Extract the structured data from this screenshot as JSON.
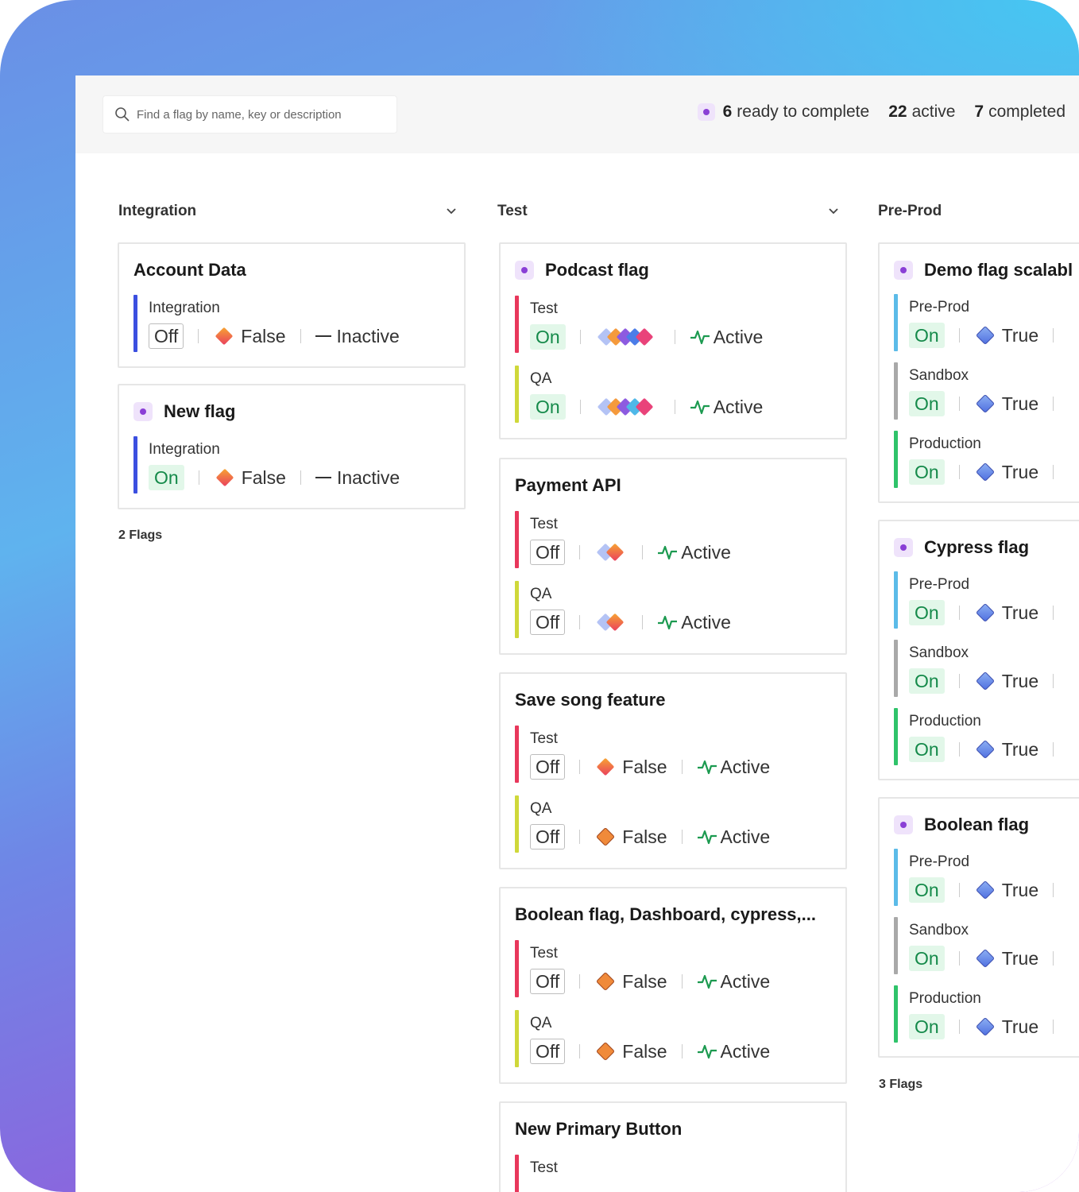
{
  "search": {
    "placeholder": "Find a flag by name, key or description"
  },
  "stats": {
    "ready_count": "6",
    "ready_label": "ready to complete",
    "active_count": "22",
    "active_label": "active",
    "completed_count": "7",
    "completed_label": "completed"
  },
  "columns": [
    {
      "title": "Integration",
      "footer": "2 Flags",
      "cards": [
        {
          "title": "Account Data",
          "envs": [
            {
              "name": "Integration",
              "state": "Off",
              "value": "False",
              "status": "Inactive"
            }
          ]
        },
        {
          "title": "New flag",
          "envs": [
            {
              "name": "Integration",
              "state": "On",
              "value": "False",
              "status": "Inactive"
            }
          ]
        }
      ]
    },
    {
      "title": "Test",
      "cards": [
        {
          "title": "Podcast flag",
          "envs": [
            {
              "name": "Test",
              "state": "On",
              "status": "Active"
            },
            {
              "name": "QA",
              "state": "On",
              "status": "Active"
            }
          ]
        },
        {
          "title": "Payment API",
          "envs": [
            {
              "name": "Test",
              "state": "Off",
              "status": "Active"
            },
            {
              "name": "QA",
              "state": "Off",
              "status": "Active"
            }
          ]
        },
        {
          "title": "Save song feature",
          "envs": [
            {
              "name": "Test",
              "state": "Off",
              "value": "False",
              "status": "Active"
            },
            {
              "name": "QA",
              "state": "Off",
              "value": "False",
              "status": "Active"
            }
          ]
        },
        {
          "title": "Boolean flag, Dashboard, cypress,...",
          "envs": [
            {
              "name": "Test",
              "state": "Off",
              "value": "False",
              "status": "Active"
            },
            {
              "name": "QA",
              "state": "Off",
              "value": "False",
              "status": "Active"
            }
          ]
        },
        {
          "title": "New Primary Button",
          "envs": [
            {
              "name": "Test"
            }
          ]
        }
      ]
    },
    {
      "title": "Pre-Prod",
      "footer": "3 Flags",
      "cards": [
        {
          "title": "Demo flag scalabl",
          "envs": [
            {
              "name": "Pre-Prod",
              "state": "On",
              "value": "True"
            },
            {
              "name": "Sandbox",
              "state": "On",
              "value": "True"
            },
            {
              "name": "Production",
              "state": "On",
              "value": "True"
            }
          ]
        },
        {
          "title": "Cypress flag",
          "envs": [
            {
              "name": "Pre-Prod",
              "state": "On",
              "value": "True"
            },
            {
              "name": "Sandbox",
              "state": "On",
              "value": "True"
            },
            {
              "name": "Production",
              "state": "On",
              "value": "True"
            }
          ]
        },
        {
          "title": "Boolean flag",
          "envs": [
            {
              "name": "Pre-Prod",
              "state": "On",
              "value": "True"
            },
            {
              "name": "Sandbox",
              "state": "On",
              "value": "True"
            },
            {
              "name": "Production",
              "state": "On",
              "value": "True"
            }
          ]
        }
      ]
    }
  ],
  "colors": {
    "integration": "#3b4fe0",
    "test": "#e8375b",
    "qa": "#cfd83a",
    "preprod": "#5bbbe8",
    "sandbox": "#a9a9a9",
    "production": "#2fc36a",
    "active_green": "#1c9a50"
  }
}
